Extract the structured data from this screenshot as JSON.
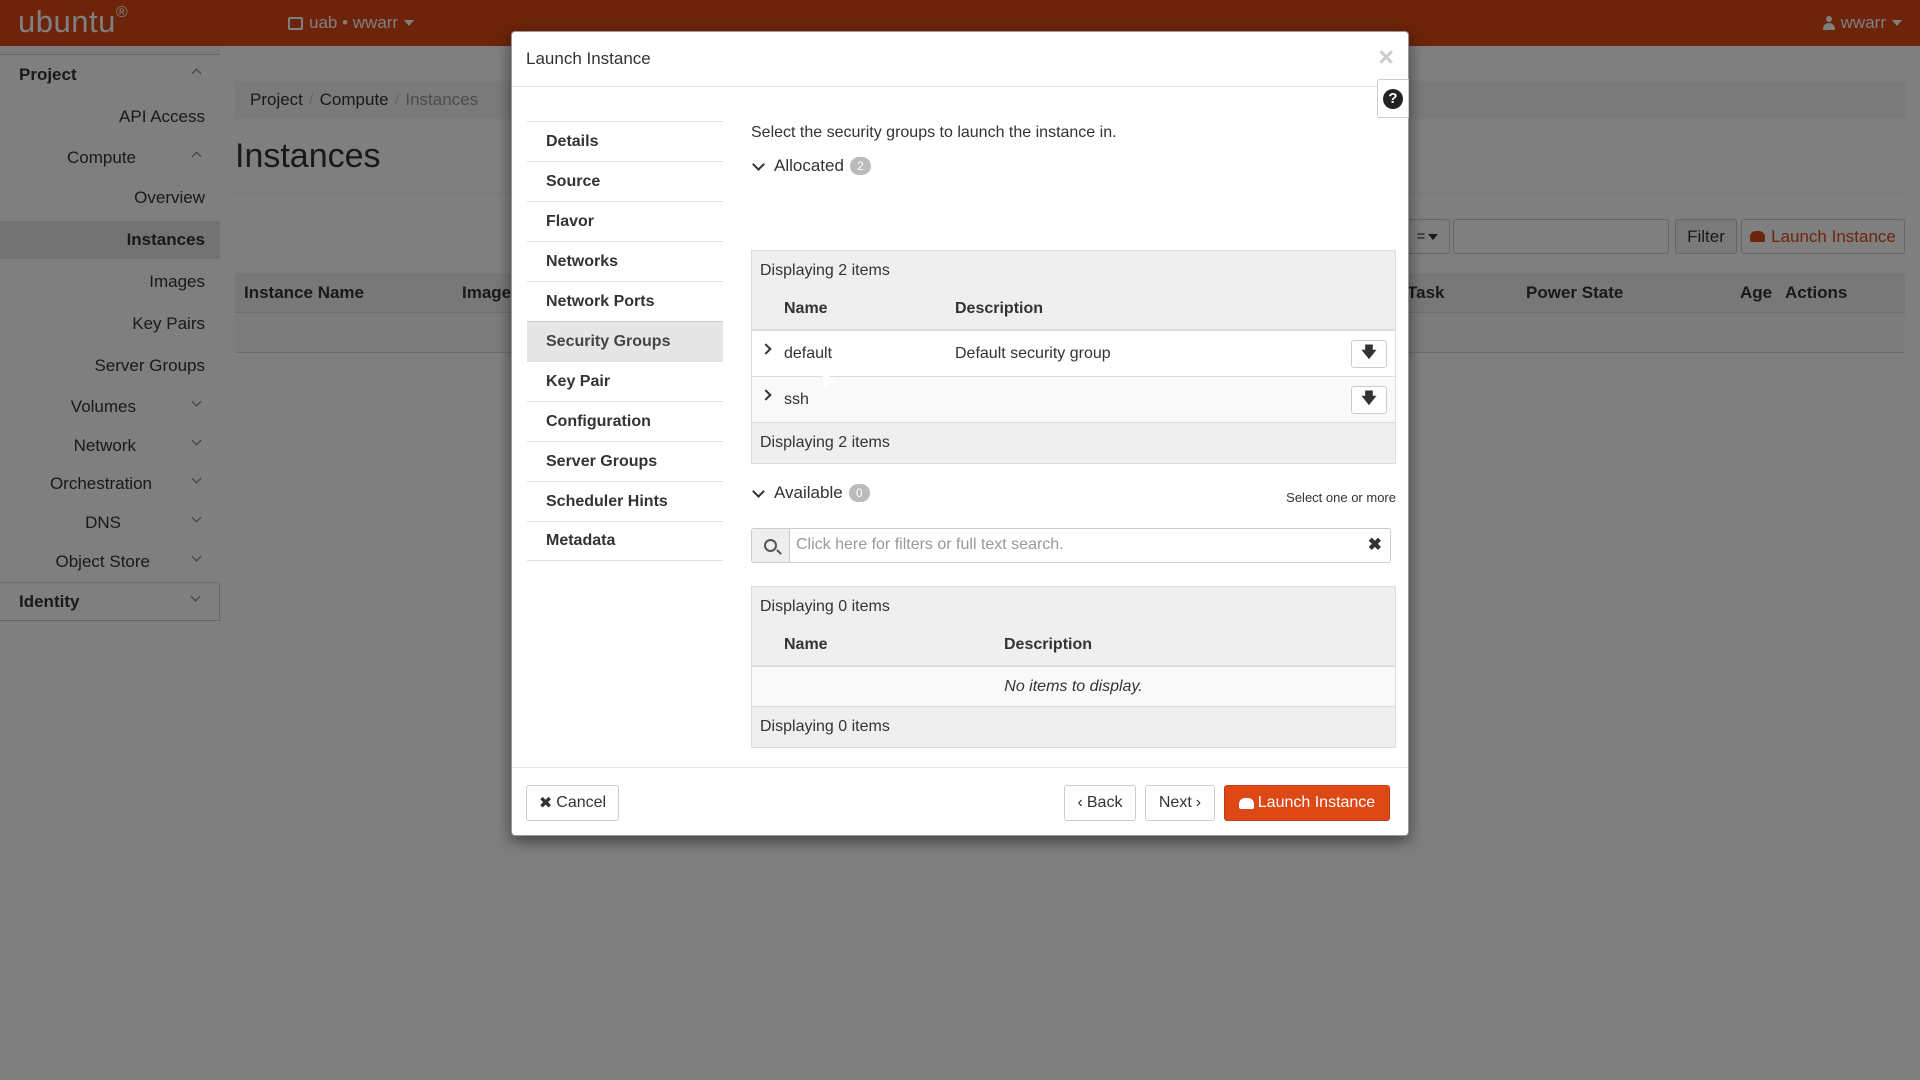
{
  "navbar": {
    "logo": "ubuntu",
    "logo_mark": "®",
    "project_switch": "uab • wwarr",
    "user": "wwarr"
  },
  "sidebar": {
    "project": "Project",
    "api_access": "API Access",
    "compute": "Compute",
    "overview": "Overview",
    "instances": "Instances",
    "images": "Images",
    "key_pairs": "Key Pairs",
    "server_groups": "Server Groups",
    "volumes": "Volumes",
    "network": "Network",
    "orchestration": "Orchestration",
    "dns": "DNS",
    "object_store": "Object Store",
    "identity": "Identity"
  },
  "page": {
    "breadcrumb": [
      "Project",
      "Compute",
      "Instances"
    ],
    "title": "Instances",
    "filter_label": "Filter",
    "launch_label": "Launch Instance",
    "select_value": "=",
    "columns": [
      "Instance Name",
      "Image",
      "Task",
      "Power State",
      "Age",
      "Actions"
    ]
  },
  "modal": {
    "title": "Launch Instance",
    "close": "×",
    "help": "?",
    "nav": [
      {
        "label": "Details",
        "active": false
      },
      {
        "label": "Source",
        "active": false
      },
      {
        "label": "Flavor",
        "active": false
      },
      {
        "label": "Networks",
        "active": false
      },
      {
        "label": "Network Ports",
        "active": false
      },
      {
        "label": "Security Groups",
        "active": true
      },
      {
        "label": "Key Pair",
        "active": false
      },
      {
        "label": "Configuration",
        "active": false
      },
      {
        "label": "Server Groups",
        "active": false
      },
      {
        "label": "Scheduler Hints",
        "active": false
      },
      {
        "label": "Metadata",
        "active": false
      }
    ],
    "intro": "Select the security groups to launch the instance in.",
    "allocated": {
      "label": "Allocated",
      "count": "2",
      "caption": "Displaying 2 items",
      "footer": "Displaying 2 items",
      "col_name": "Name",
      "col_description": "Description",
      "rows": [
        {
          "name": "default",
          "description": "Default security group"
        },
        {
          "name": "ssh",
          "description": ""
        }
      ]
    },
    "available": {
      "label": "Available",
      "count": "0",
      "hint": "Select one or more",
      "search_placeholder": "Click here for filters or full text search.",
      "caption": "Displaying 0 items",
      "footer": "Displaying 0 items",
      "col_name": "Name",
      "col_description": "Description",
      "empty": "No items to display."
    },
    "footer": {
      "cancel": "Cancel",
      "back": "Back",
      "next": "Next",
      "launch": "Launch Instance"
    }
  },
  "colors": {
    "brand": "#dd4814",
    "overlay": "rgba(0,0,0,0.5)"
  },
  "icons": {
    "project_switch": "desktop-icon",
    "user": "user-icon",
    "help": "question-circle-icon",
    "search": "search-icon",
    "clear": "times-icon",
    "move_down": "arrow-down-icon",
    "launch": "cloud-upload-icon"
  }
}
